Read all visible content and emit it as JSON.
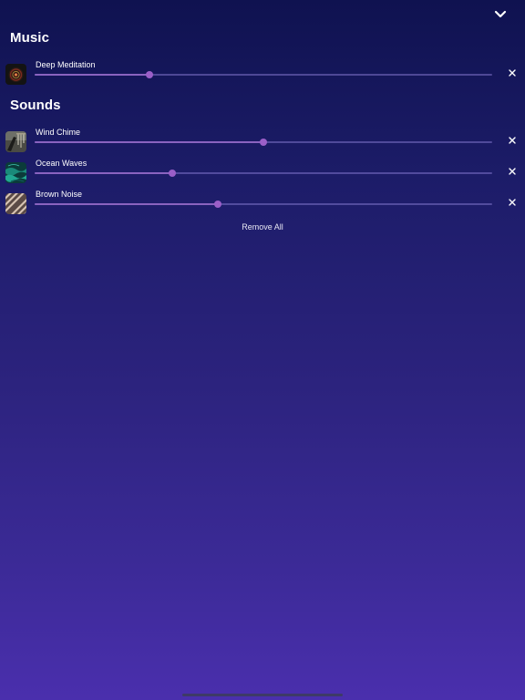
{
  "header": {
    "collapse_icon": "chevron-down-icon"
  },
  "sections": {
    "music_title": "Music",
    "sounds_title": "Sounds"
  },
  "music": [
    {
      "name": "Deep Meditation",
      "volume": 0.25,
      "thumb_icon": "meditation-artwork-icon",
      "remove_icon": "close-icon"
    }
  ],
  "sounds": [
    {
      "name": "Wind Chime",
      "volume": 0.5,
      "thumb_icon": "wind-chime-artwork-icon",
      "remove_icon": "close-icon"
    },
    {
      "name": "Ocean Waves",
      "volume": 0.3,
      "thumb_icon": "ocean-waves-artwork-icon",
      "remove_icon": "close-icon"
    },
    {
      "name": "Brown Noise",
      "volume": 0.4,
      "thumb_icon": "brown-noise-artwork-icon",
      "remove_icon": "close-icon"
    }
  ],
  "actions": {
    "remove_all_label": "Remove All"
  },
  "colors": {
    "background_top": "#0f1250",
    "background_bottom": "#4a2fad",
    "slider_knob": "#9b5fc8",
    "slider_track": "#5a4fa0"
  }
}
